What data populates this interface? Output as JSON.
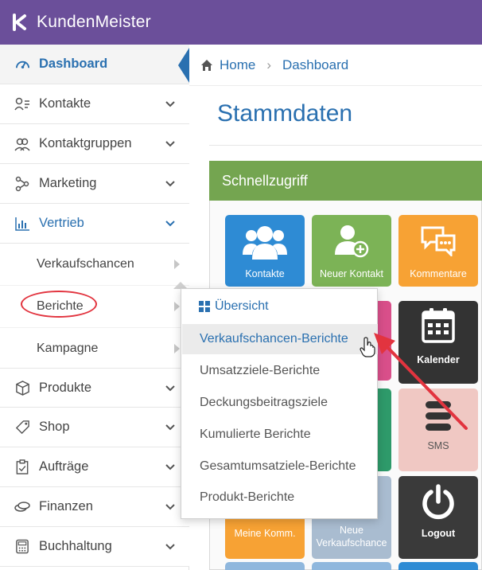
{
  "app": {
    "title": "KundenMeister"
  },
  "sidebar": {
    "items": [
      {
        "label": "Dashboard",
        "icon": "gauge-icon"
      },
      {
        "label": "Kontakte",
        "icon": "contacts-icon"
      },
      {
        "label": "Kontaktgruppen",
        "icon": "group-icon"
      },
      {
        "label": "Marketing",
        "icon": "network-icon"
      },
      {
        "label": "Vertrieb",
        "icon": "bar-chart-icon"
      },
      {
        "label": "Produkte",
        "icon": "box-icon"
      },
      {
        "label": "Shop",
        "icon": "tag-icon"
      },
      {
        "label": "Aufträge",
        "icon": "clipboard-check-icon"
      },
      {
        "label": "Finanzen",
        "icon": "coins-icon"
      },
      {
        "label": "Buchhaltung",
        "icon": "calculator-icon"
      }
    ],
    "vertrieb_sub": [
      {
        "label": "Verkaufschancen"
      },
      {
        "label": "Berichte"
      },
      {
        "label": "Kampagne"
      }
    ]
  },
  "breadcrumb": {
    "home": "Home",
    "current": "Dashboard"
  },
  "page": {
    "title": "Stammdaten"
  },
  "panel": {
    "title": "Schnellzugriff",
    "tiles": [
      {
        "label": "Kontakte",
        "color": "#2e8bd4"
      },
      {
        "label": "Neuer Kontakt",
        "color": "#7cb356"
      },
      {
        "label": "Kommentare",
        "color": "#f7a234"
      },
      {
        "label": "Kalender",
        "color": "#333333"
      },
      {
        "label": "SMS",
        "color": "#f0c8c3"
      },
      {
        "label": "Meine Komm.",
        "color": "#f7a234"
      },
      {
        "label": "Neue Verkaufschance",
        "color": "#a9bcd0"
      },
      {
        "label": "Logout",
        "color": "#3a3a3a"
      }
    ]
  },
  "dropdown": {
    "header": "Übersicht",
    "items": [
      {
        "label": "Verkaufschancen-Berichte"
      },
      {
        "label": "Umsatzziele-Berichte"
      },
      {
        "label": "Deckungsbeitragsziele"
      },
      {
        "label": "Kumulierte Berichte"
      },
      {
        "label": "Gesamtumsatziele-Berichte"
      },
      {
        "label": "Produkt-Berichte"
      }
    ]
  },
  "colors": {
    "header_bg": "#6b4f9a",
    "accent": "#2a70b0",
    "panel_head": "#74a550",
    "annotation": "#e2343f"
  }
}
